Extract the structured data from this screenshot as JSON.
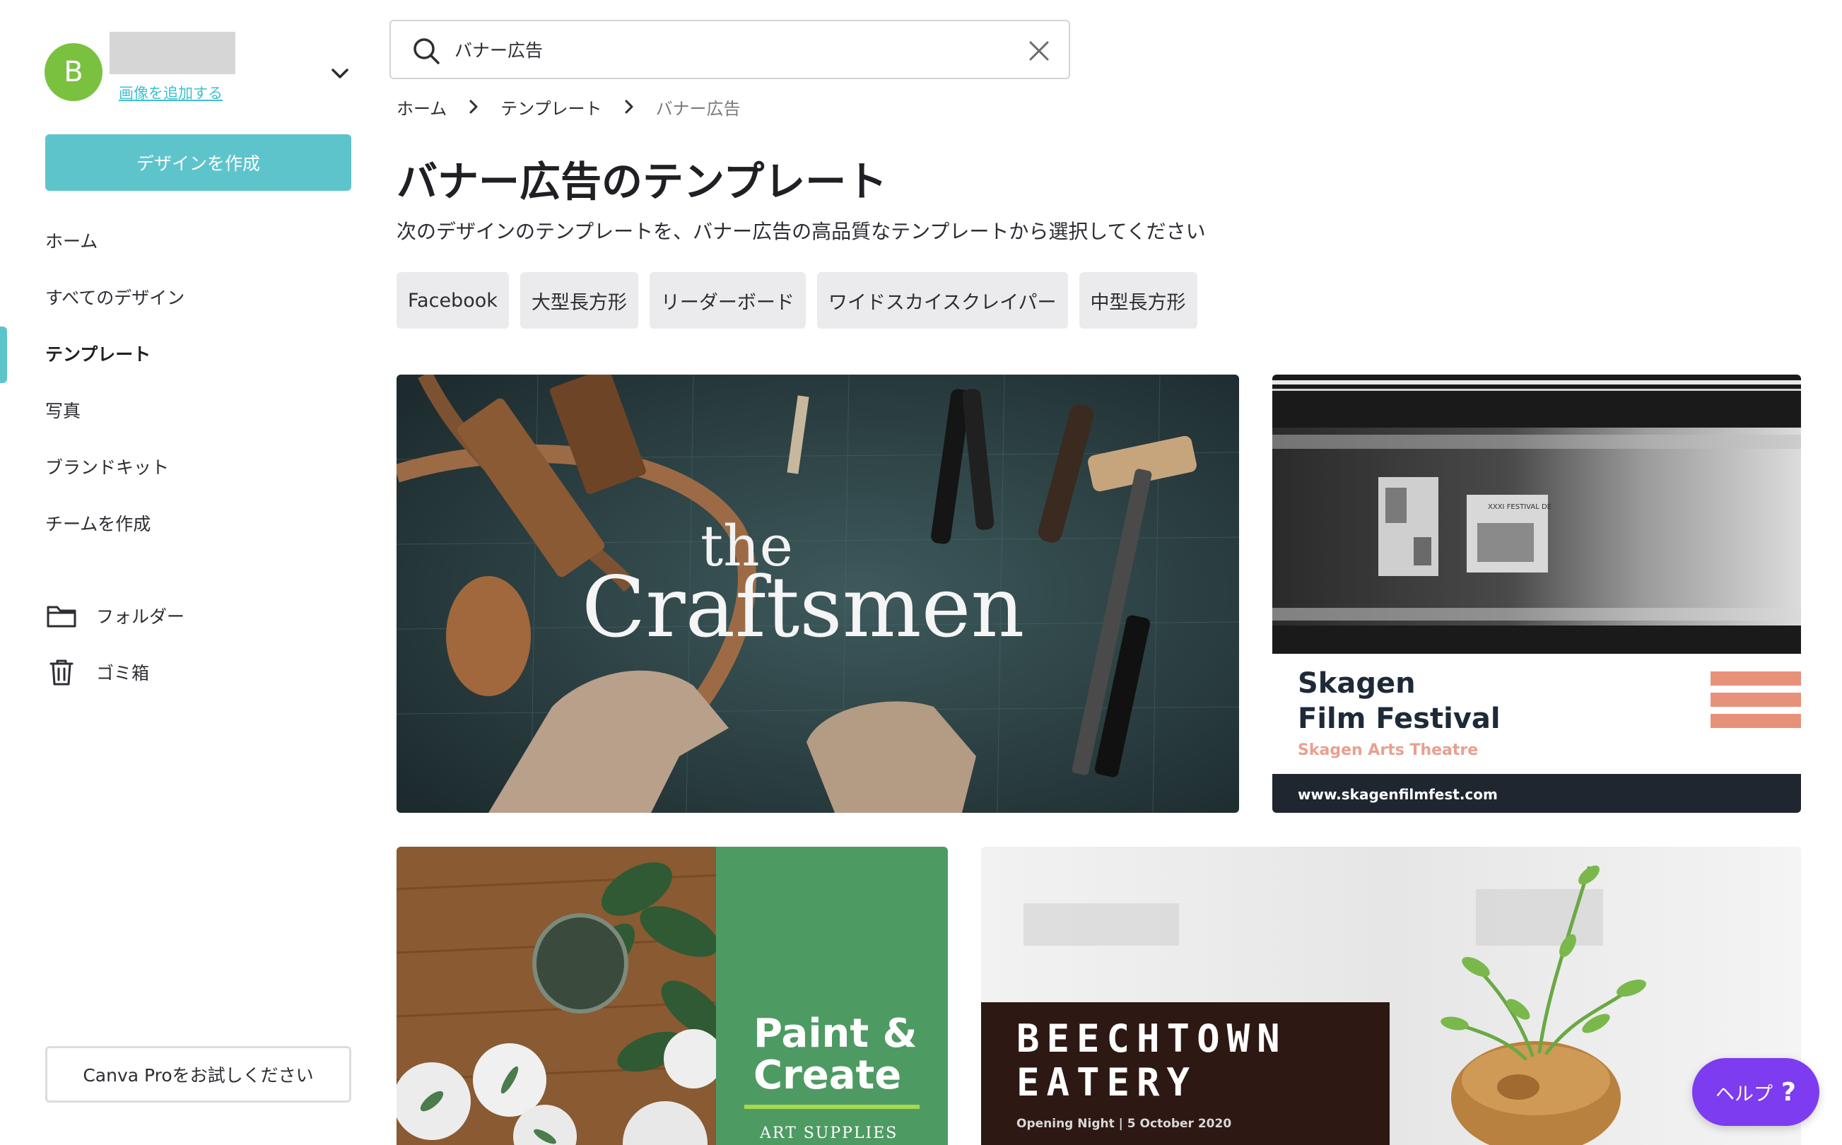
{
  "account": {
    "avatar_initial": "B",
    "add_image_label": "画像を追加する"
  },
  "sidebar": {
    "create_design_label": "デザインを作成",
    "nav": [
      {
        "label": "ホーム"
      },
      {
        "label": "すべてのデザイン"
      },
      {
        "label": "テンプレート",
        "active": true
      },
      {
        "label": "写真"
      },
      {
        "label": "ブランドキット"
      },
      {
        "label": "チームを作成"
      }
    ],
    "folders_label": "フォルダー",
    "trash_label": "ゴミ箱",
    "try_pro_label": "Canva Proをお試しください"
  },
  "search": {
    "value": "バナー広告"
  },
  "breadcrumb": [
    {
      "label": "ホーム"
    },
    {
      "label": "テンプレート"
    },
    {
      "label": "バナー広告"
    }
  ],
  "page": {
    "title": "バナー広告のテンプレート",
    "subtitle": "次のデザインのテンプレートを、バナー広告の高品質なテンプレートから選択してください"
  },
  "chips": [
    {
      "label": "Facebook"
    },
    {
      "label": "大型長方形"
    },
    {
      "label": "リーダーボード"
    },
    {
      "label": "ワイドスカイスクレイパー"
    },
    {
      "label": "中型長方形"
    }
  ],
  "templates": {
    "craftsmen": {
      "line1": "the",
      "line2": "Craftsmen"
    },
    "skagen": {
      "poster_tag": "XXXI FESTIVAL DE",
      "title_line1": "Skagen",
      "title_line2": "Film Festival",
      "subtitle": "Skagen Arts Theatre",
      "url": "www.skagenfilmfest.com"
    },
    "paint": {
      "line1": "Paint &",
      "line2": "Create",
      "subtitle": "ART SUPPLIES"
    },
    "beechtown": {
      "line1": "BEECHTOWN",
      "line2": "EATERY",
      "subtitle": "Opening Night | 5 October 2020"
    }
  },
  "help": {
    "label": "ヘルプ",
    "icon": "?"
  },
  "colors": {
    "accent": "#5ec4cc",
    "avatar": "#7ac13f",
    "help": "#7d3cf0"
  }
}
